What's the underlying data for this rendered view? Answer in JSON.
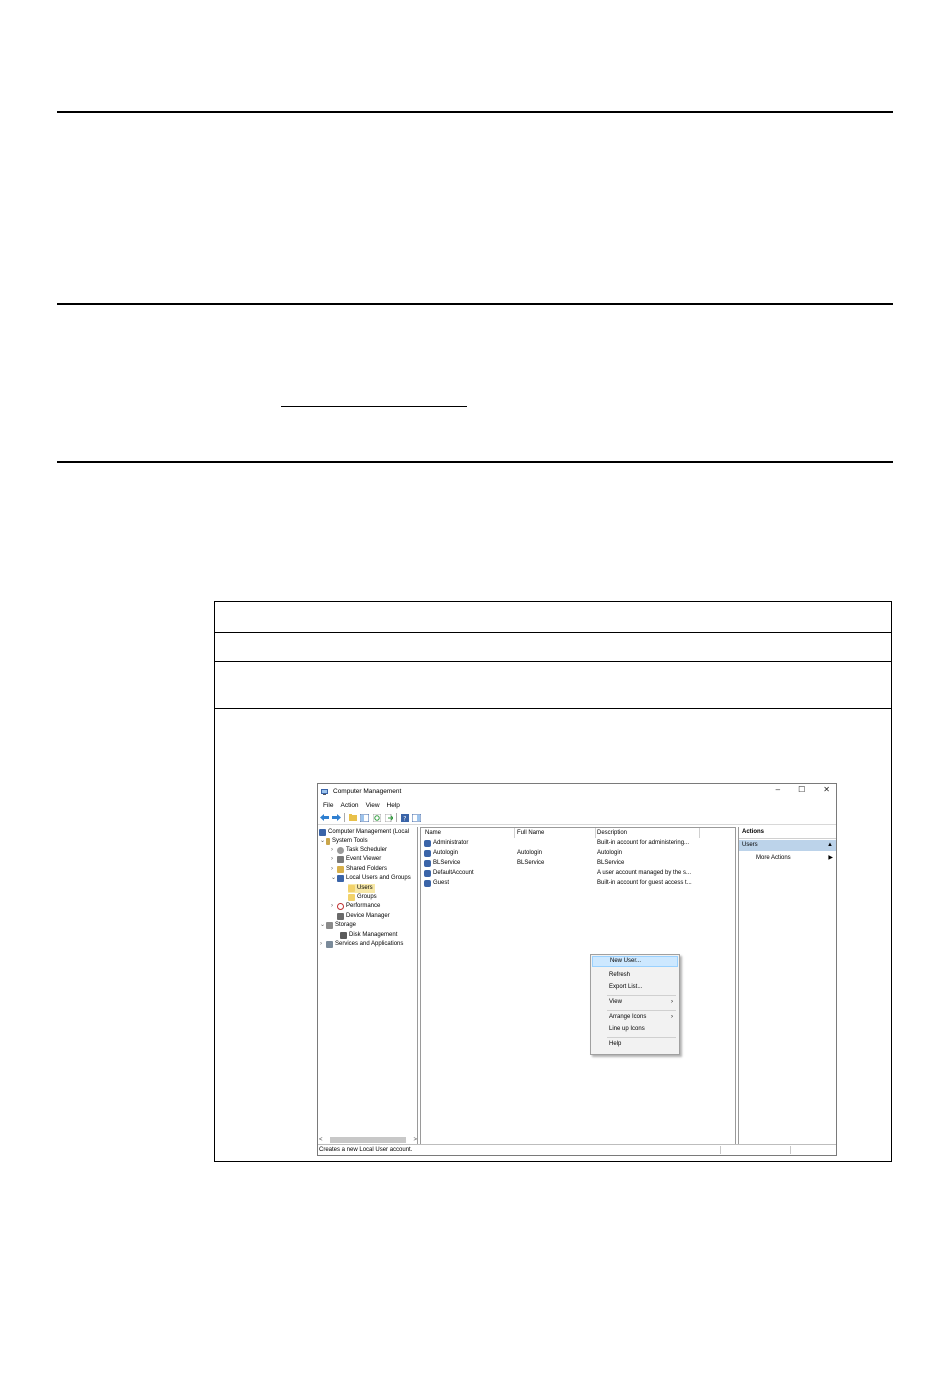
{
  "window": {
    "title": "Computer Management",
    "controls": [
      "–",
      "☐",
      "✕"
    ]
  },
  "menubar": [
    "File",
    "Action",
    "View",
    "Help"
  ],
  "toolbar_icons": [
    "back-arrow-icon",
    "forward-arrow-icon",
    "up-folder-icon",
    "show-hide-console-tree-icon",
    "refresh-icon",
    "export-list-icon",
    "help-icon",
    "mmc-icon"
  ],
  "tree": {
    "root": "Computer Management (Local",
    "system_tools": "System Tools",
    "task_scheduler": "Task Scheduler",
    "event_viewer": "Event Viewer",
    "shared_folders": "Shared Folders",
    "local_users_groups": "Local Users and Groups",
    "users": "Users",
    "groups": "Groups",
    "performance": "Performance",
    "device_manager": "Device Manager",
    "storage": "Storage",
    "disk_management": "Disk Management",
    "services_apps": "Services and Applications",
    "scroll_left": "<",
    "scroll_right": ">"
  },
  "list": {
    "headers": {
      "name": "Name",
      "full_name": "Full Name",
      "description": "Description"
    },
    "rows": [
      {
        "name": "Administrator",
        "full_name": "",
        "description": "Built-in account for administering..."
      },
      {
        "name": "Autologin",
        "full_name": "Autologin",
        "description": "Autologin"
      },
      {
        "name": "BLService",
        "full_name": "BLService",
        "description": "BLService"
      },
      {
        "name": "DefaultAccount",
        "full_name": "",
        "description": "A user account managed by the s..."
      },
      {
        "name": "Guest",
        "full_name": "",
        "description": "Built-in account for guest access t..."
      }
    ]
  },
  "context_menu": {
    "new_user": "New User...",
    "refresh": "Refresh",
    "export_list": "Export List...",
    "view": "View",
    "arrange_icons": "Arrange Icons",
    "line_up_icons": "Line up Icons",
    "help": "Help",
    "submenu_arrow": "›"
  },
  "actions": {
    "title": "Actions",
    "section": "Users",
    "section_arrow": "▲",
    "more_actions": "More Actions",
    "more_arrow": "▶"
  },
  "statusbar": {
    "text": "Creates a new Local User account."
  }
}
